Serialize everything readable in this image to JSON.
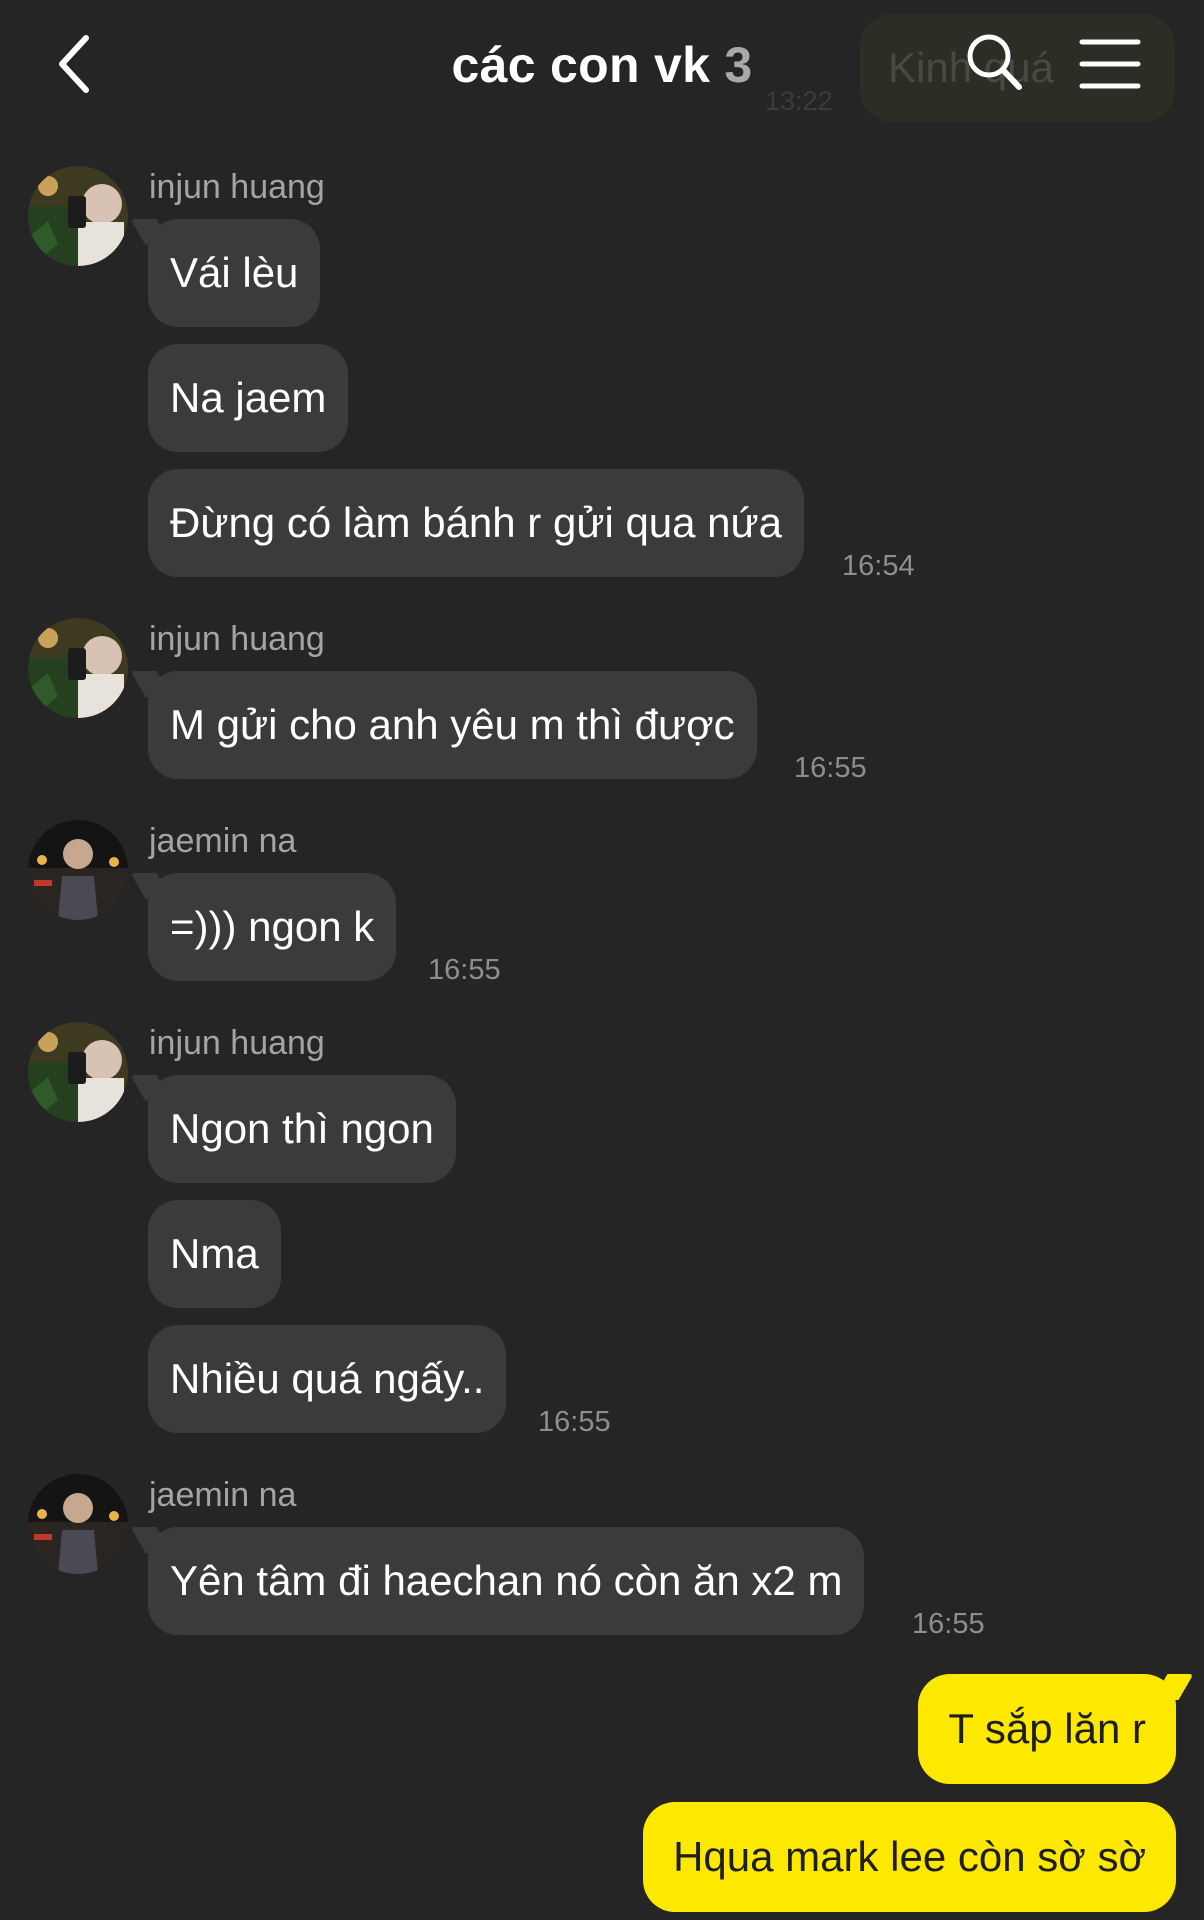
{
  "header": {
    "title": "các con vk",
    "member_count": "3",
    "background_peek_message": "Kinh quá",
    "background_peek_time": "13:22"
  },
  "messages": [
    {
      "sender": "injun huang",
      "bubbles": [
        "Vái lèu",
        "Na jaem",
        "Đừng có làm bánh r gửi qua nứa"
      ],
      "time": "16:54"
    },
    {
      "sender": "injun huang",
      "bubbles": [
        "M gửi cho anh yêu m thì được"
      ],
      "time": "16:55"
    },
    {
      "sender": "jaemin na",
      "bubbles": [
        "=))) ngon k"
      ],
      "time": "16:55"
    },
    {
      "sender": "injun huang",
      "bubbles": [
        "Ngon thì ngon",
        "Nma",
        "Nhiều quá ngấy.."
      ],
      "time": "16:55"
    },
    {
      "sender": "jaemin na",
      "bubbles": [
        "Yên tâm đi haechan nó còn ăn x2 m"
      ],
      "time": "16:55"
    }
  ],
  "my_messages": [
    "T sắp lăn r",
    "Hqua mark lee còn sờ sờ"
  ],
  "colors": {
    "background": "#252526",
    "received_bubble": "#3b3b3d",
    "sent_bubble": "#fde800",
    "sender_name": "#a4a4a4",
    "timestamp": "#8e8e8e"
  },
  "icons": [
    "back-arrow-icon",
    "search-icon",
    "menu-icon"
  ]
}
